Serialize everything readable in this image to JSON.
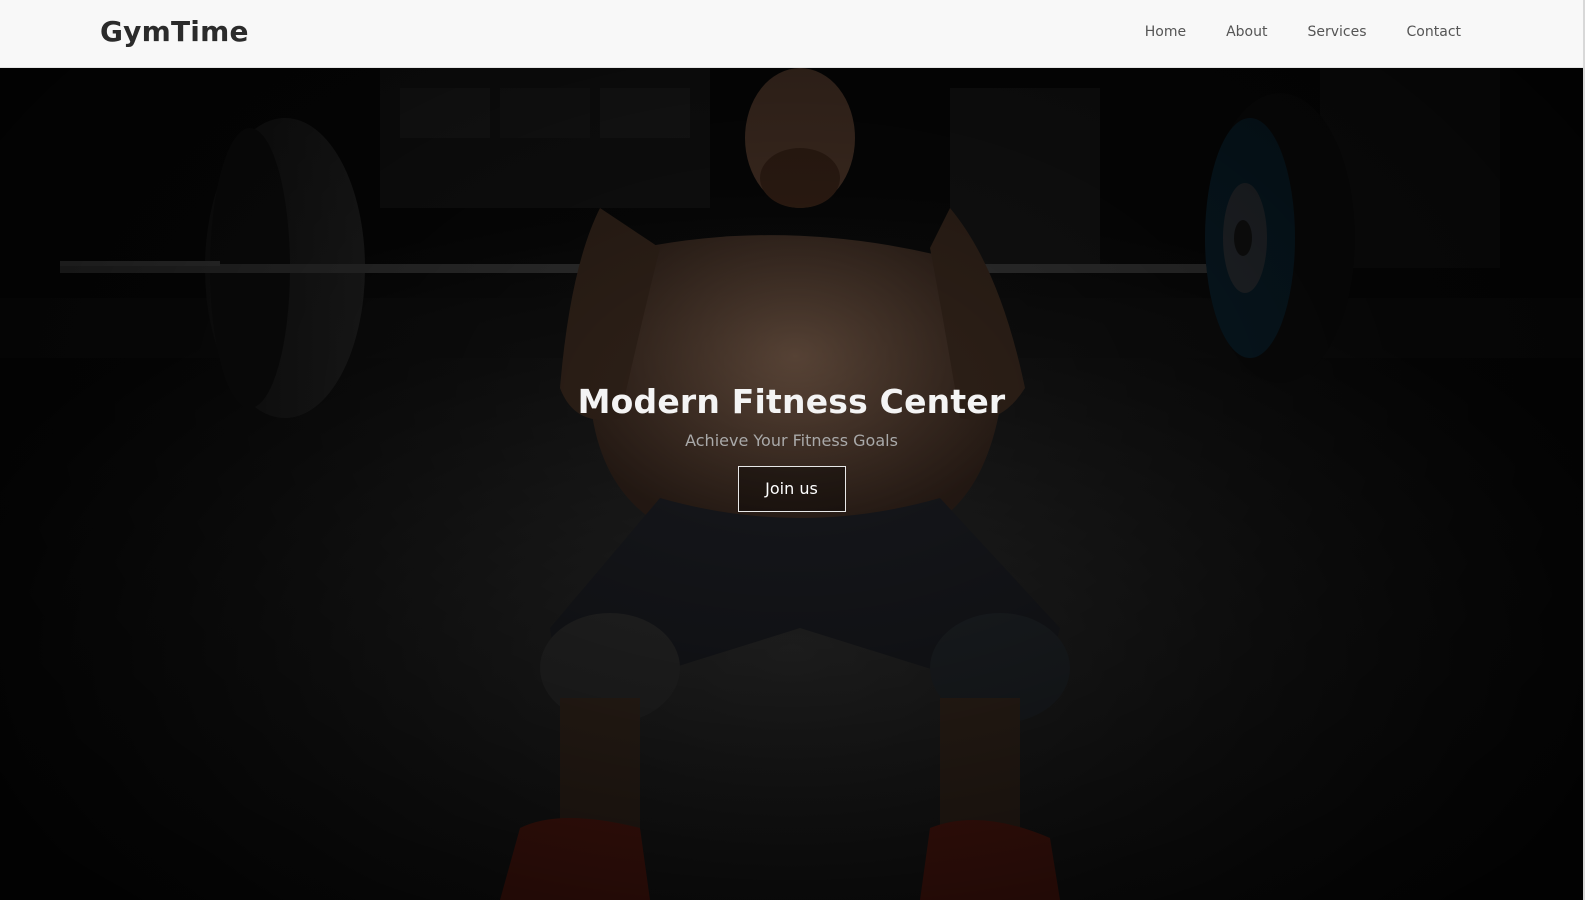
{
  "header": {
    "brand": "GymTime",
    "nav": [
      {
        "label": "Home"
      },
      {
        "label": "About"
      },
      {
        "label": "Services"
      },
      {
        "label": "Contact"
      }
    ]
  },
  "hero": {
    "title": "Modern Fitness Center",
    "subtitle": "Achieve Your Fitness Goals",
    "cta_label": "Join us",
    "image_subject": "weightlifter-front-squat-barbell"
  },
  "colors": {
    "nav_background": "#f8f8f8",
    "brand_text": "#2b2b2b",
    "nav_text": "#555555",
    "hero_title": "#f4f4f4",
    "hero_subtitle": "#a9a9a9",
    "button_border": "#e8e8e8"
  }
}
